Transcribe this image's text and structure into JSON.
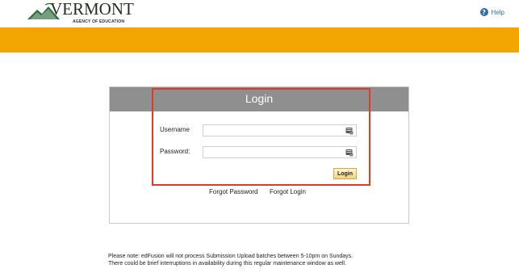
{
  "header": {
    "logo_word": "VERMONT",
    "logo_sub": "AGENCY OF EDUCATION",
    "help_label": "Help",
    "help_glyph": "?"
  },
  "colors": {
    "band": "#f3a600",
    "panel_header": "#8f8f8f",
    "highlight": "#e03a2a",
    "help": "#2b6cb0"
  },
  "login": {
    "title": "Login",
    "username_label": "Username",
    "username_value": "",
    "password_label": "Password:",
    "password_value": "",
    "login_button": "Login",
    "forgot_password": "Forgot Password",
    "forgot_login": "Forgot Login"
  },
  "notice": {
    "line1": "Please note: edFusion will not process Submission Upload batches between 5-10pm on Sundays.",
    "line2": "There could be brief interruptions in availability during this regular maintenance window as well."
  },
  "icons": [
    "mountain-logo-icon",
    "help-icon",
    "keyboard-icon"
  ]
}
